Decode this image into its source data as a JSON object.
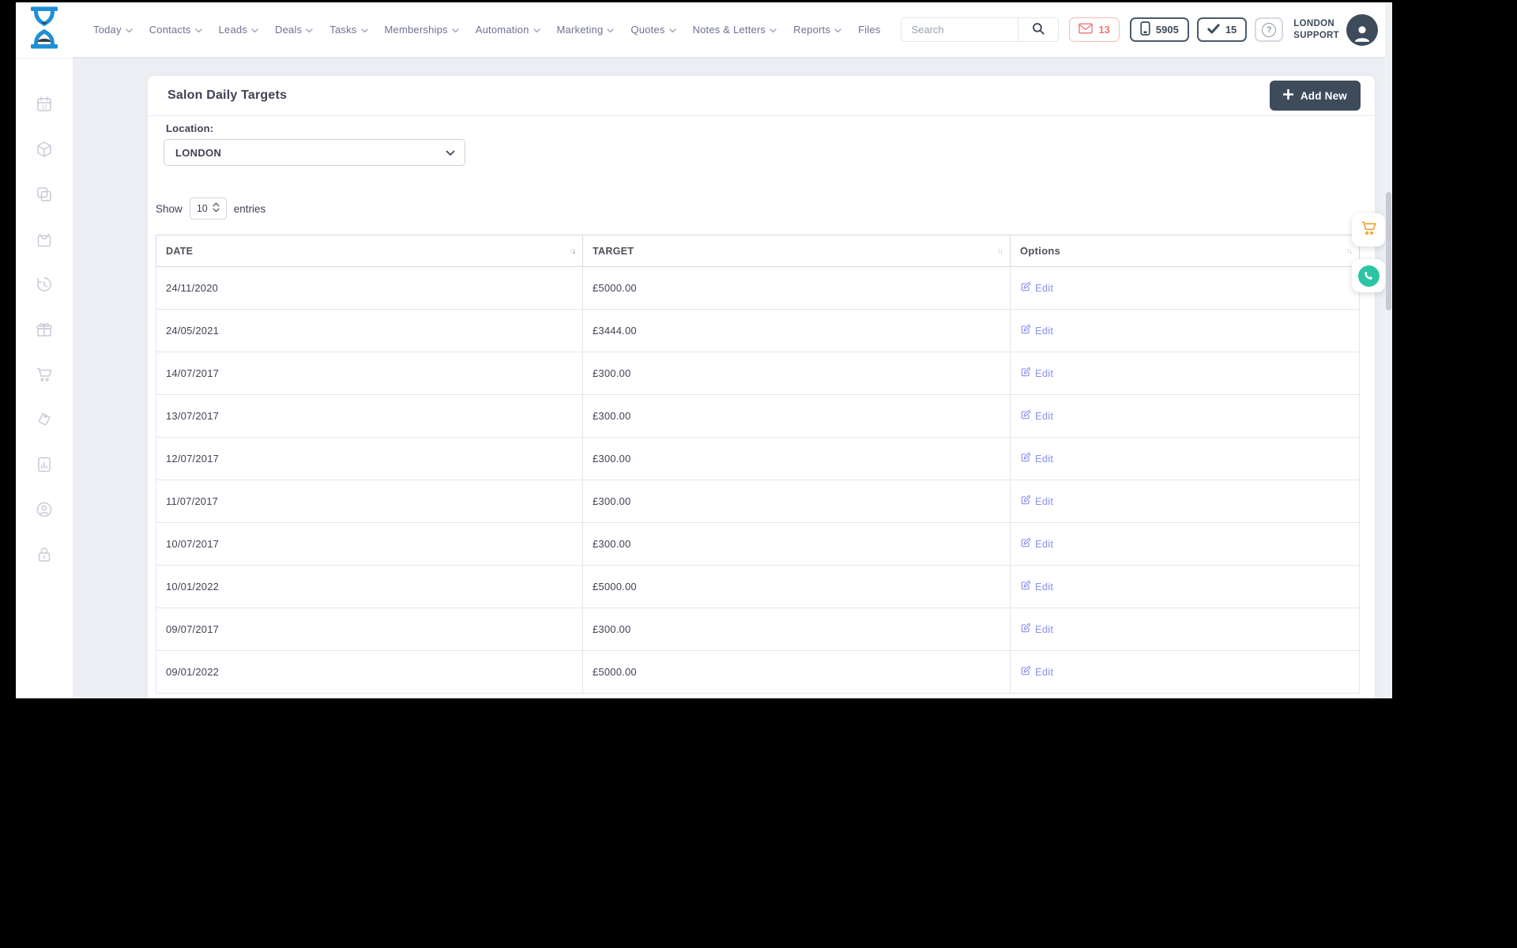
{
  "topbar": {
    "nav_items": [
      {
        "label": "Today",
        "caret": true
      },
      {
        "label": "Contacts",
        "caret": true
      },
      {
        "label": "Leads",
        "caret": true
      },
      {
        "label": "Deals",
        "caret": true
      },
      {
        "label": "Tasks",
        "caret": true
      },
      {
        "label": "Memberships",
        "caret": true
      },
      {
        "label": "Automation",
        "caret": true
      },
      {
        "label": "Marketing",
        "caret": true
      },
      {
        "label": "Quotes",
        "caret": true
      },
      {
        "label": "Notes & Letters",
        "caret": true
      },
      {
        "label": "Reports",
        "caret": true
      },
      {
        "label": "Files",
        "caret": false
      }
    ],
    "search": {
      "placeholder": "Search"
    },
    "badges": {
      "messages_count": "13",
      "phone_number": "5905",
      "tasks_count": "15",
      "help_glyph": "?"
    },
    "user": {
      "name_line1": "LONDON",
      "name_line2": "SUPPORT"
    }
  },
  "sidebar": {
    "icons": [
      "calendar-icon",
      "package-icon",
      "copy-icon",
      "shopping-bag-icon",
      "history-icon",
      "gift-icon",
      "cart-icon",
      "voucher-tag-icon",
      "report-chart-icon",
      "support-person-icon",
      "lock-icon"
    ]
  },
  "page": {
    "title": "Salon Daily Targets",
    "add_new_label": "Add New",
    "location": {
      "label": "Location:",
      "value": "LONDON"
    },
    "length_control": {
      "show_label": "Show",
      "value": "10",
      "entries_label": "entries"
    },
    "table": {
      "columns": [
        {
          "label": "DATE",
          "sort_state": "desc"
        },
        {
          "label": "TARGET",
          "sort_state": "none"
        },
        {
          "label": "Options",
          "sort_state": "none"
        }
      ],
      "edit_label": "Edit",
      "rows": [
        {
          "date": "24/11/2020",
          "target": "£5000.00"
        },
        {
          "date": "24/05/2021",
          "target": "£3444.00"
        },
        {
          "date": "14/07/2017",
          "target": "£300.00"
        },
        {
          "date": "13/07/2017",
          "target": "£300.00"
        },
        {
          "date": "12/07/2017",
          "target": "£300.00"
        },
        {
          "date": "11/07/2017",
          "target": "£300.00"
        },
        {
          "date": "10/07/2017",
          "target": "£300.00"
        },
        {
          "date": "10/01/2022",
          "target": "£5000.00"
        },
        {
          "date": "09/07/2017",
          "target": "£300.00"
        },
        {
          "date": "09/01/2022",
          "target": "£5000.00"
        }
      ]
    }
  },
  "colors": {
    "accent_dark": "#3e4b5b",
    "alert_red": "#ee7576",
    "link_blue": "#8a91ef",
    "logo_blue": "#1d8fd7",
    "cart_orange": "#f3a23a",
    "phone_teal": "#2bc5a4",
    "content_bg": "#edeff4"
  }
}
